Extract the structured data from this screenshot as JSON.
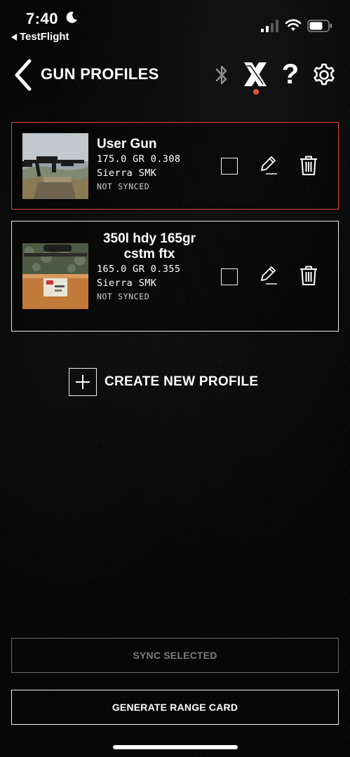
{
  "status_bar": {
    "time": "7:40",
    "back_app_label": "TestFlight"
  },
  "header": {
    "title": "GUN PROFILES",
    "icons": [
      "back-chevron-icon",
      "bluetooth-icon",
      "x-device-icon",
      "help-icon",
      "gear-icon"
    ],
    "help_glyph": "?",
    "device_status_color": "#e8553f"
  },
  "profiles": [
    {
      "name": "User Gun",
      "spec": "175.0 GR 0.308",
      "bullet": "Sierra SMK",
      "sync_state": "NOT SYNCED",
      "selected": true,
      "checked": false
    },
    {
      "name": "350l hdy 165gr cstm ftx",
      "spec": "165.0 GR 0.355",
      "bullet": "Sierra SMK",
      "sync_state": "NOT SYNCED",
      "selected": false,
      "checked": false
    }
  ],
  "create_new_label": "CREATE NEW PROFILE",
  "buttons": {
    "sync_selected": "SYNC SELECTED",
    "generate_range_card": "GENERATE RANGE CARD"
  },
  "colors": {
    "background": "#060606",
    "selected_border": "#d9483b",
    "disabled_text": "#7b7b7b"
  }
}
